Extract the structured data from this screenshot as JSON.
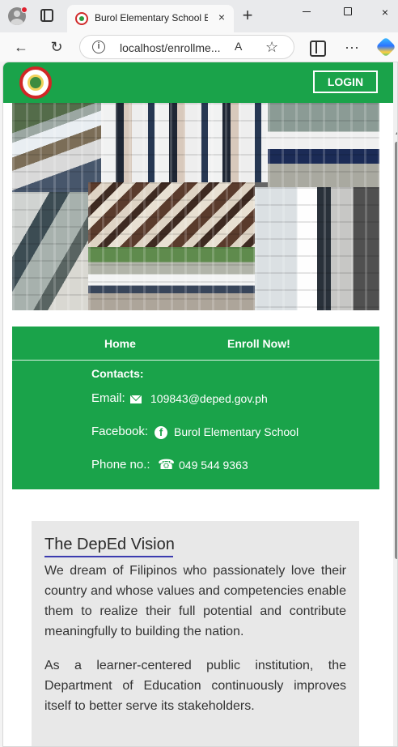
{
  "browser": {
    "tab_title": "Burol Elementary School E",
    "tab_close": "×",
    "new_tab": "+",
    "window_close": "×",
    "url": "localhost/enrollme...",
    "icons": [
      "profile-icon",
      "tab-actions-icon",
      "back-icon",
      "reload-icon",
      "info-icon",
      "read-aloud-icon",
      "favorite-icon",
      "split-screen-icon",
      "more-icon",
      "copilot-icon"
    ],
    "reader_label": "A",
    "favorite_label": "☆",
    "more_label": "···",
    "back_label": "←",
    "reload_label": "↻"
  },
  "site": {
    "login": "LOGIN",
    "brand_color": "#1aa34a",
    "nav": {
      "home": "Home",
      "enroll": "Enroll Now!"
    },
    "contacts": {
      "heading": "Contacts:",
      "email_label": "Email:",
      "email_value": "109843@deped.gov.ph",
      "facebook_label": "Facebook:",
      "facebook_value": "Burol Elementary School",
      "phone_label": "Phone no.:",
      "phone_value": "049 544 9363"
    },
    "vision": {
      "title": "The DepEd Vision",
      "paragraph_1": "We dream of Filipinos who passionately love their country and whose values and competencies enable them to realize their full potential and contribute meaningfully to building the nation.",
      "paragraph_2": "As a learner-centered public institution, the Department of Education continuously improves itself to better serve its stakeholders."
    }
  }
}
